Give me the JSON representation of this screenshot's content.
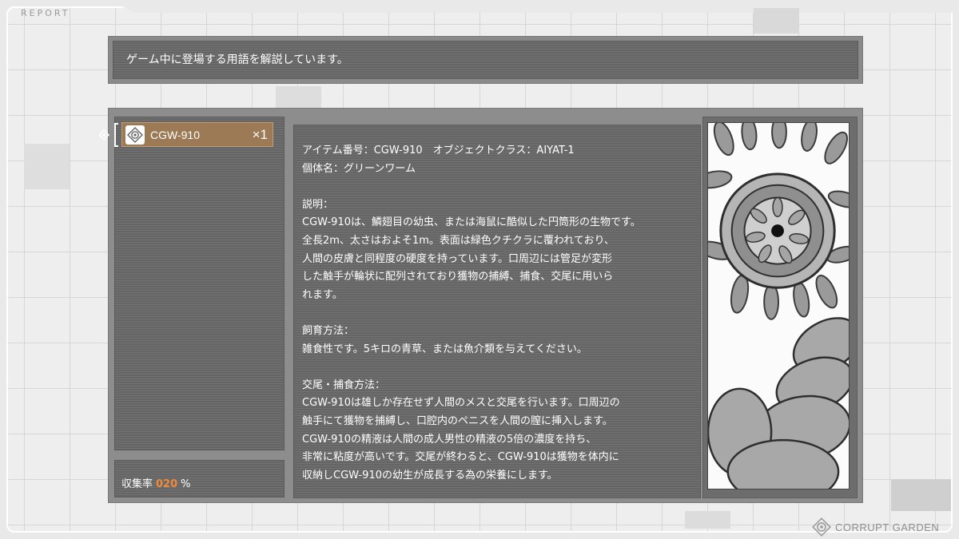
{
  "report_label": "REPORT",
  "header": {
    "text": "ゲーム中に登場する用語を解説しています。"
  },
  "list": {
    "items": [
      {
        "name": "CGW-910",
        "count": "×1",
        "icon": "target-icon"
      }
    ]
  },
  "collection": {
    "label": "収集率",
    "value": "020",
    "unit": "%"
  },
  "description": {
    "text": "アイテム番号：CGW-910　オブジェクトクラス：AIYAT-1\n個体名：グリーンワーム\n\n説明：\nCGW-910は、鱗翅目の幼虫、または海鼠に酷似した円筒形の生物です。\n全長2m、太さはおよそ1m。表面は緑色クチクラに覆われており、\n人間の皮膚と同程度の硬度を持っています。口周辺には管足が変形\nした触手が輪状に配列されており獲物の捕縛、捕食、交尾に用いら\nれます。\n\n飼育方法：\n雑食性です。5キロの青草、または魚介類を与えてください。\n\n交尾・捕食方法：\nCGW-910は雄しか存在せず人間のメスと交尾を行います。口周辺の\n触手にて獲物を捕縛し、口腔内のペニスを人間の膣に挿入します。\nCGW-910の精液は人間の成人男性の精液の5倍の濃度を持ち、\n非常に粘度が高いです。交尾が終わると、CGW-910は獲物を体内に\n収納しCGW-910の幼生が成長する為の栄養にします。"
  },
  "brand": {
    "text": "CORRUPT GARDEN",
    "icon": "target-icon"
  },
  "colors": {
    "highlight": "#9c7a56",
    "rate": "#f08a3a",
    "panel": "#6a6a6a"
  }
}
